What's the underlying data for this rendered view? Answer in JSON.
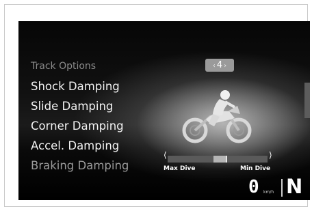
{
  "menu": {
    "items": [
      {
        "label": "Track Options",
        "style": "dim"
      },
      {
        "label": "Shock Damping",
        "style": "normal"
      },
      {
        "label": "Slide Damping",
        "style": "normal"
      },
      {
        "label": "Corner Damping",
        "style": "normal"
      },
      {
        "label": "Accel. Damping",
        "style": "normal"
      },
      {
        "label": "Braking Damping",
        "style": "muted"
      }
    ]
  },
  "selector": {
    "left_arrow": "‹",
    "value": "4",
    "right_arrow": "›"
  },
  "slider": {
    "left_bracket": "⟨",
    "right_bracket": "⟩",
    "min_label": "Max Dive",
    "max_label": "Min Dive",
    "level_fraction": 0.52
  },
  "status": {
    "speed": "0",
    "speed_unit": "km/h",
    "gear": "N"
  },
  "icons": {
    "rider": "motorcycle-rider-icon"
  },
  "colors": {
    "screen_bg": "#000000",
    "text": "#f2f2f2",
    "dim_text": "#8a8a8a",
    "selector_bg": "#9a9a9a"
  }
}
